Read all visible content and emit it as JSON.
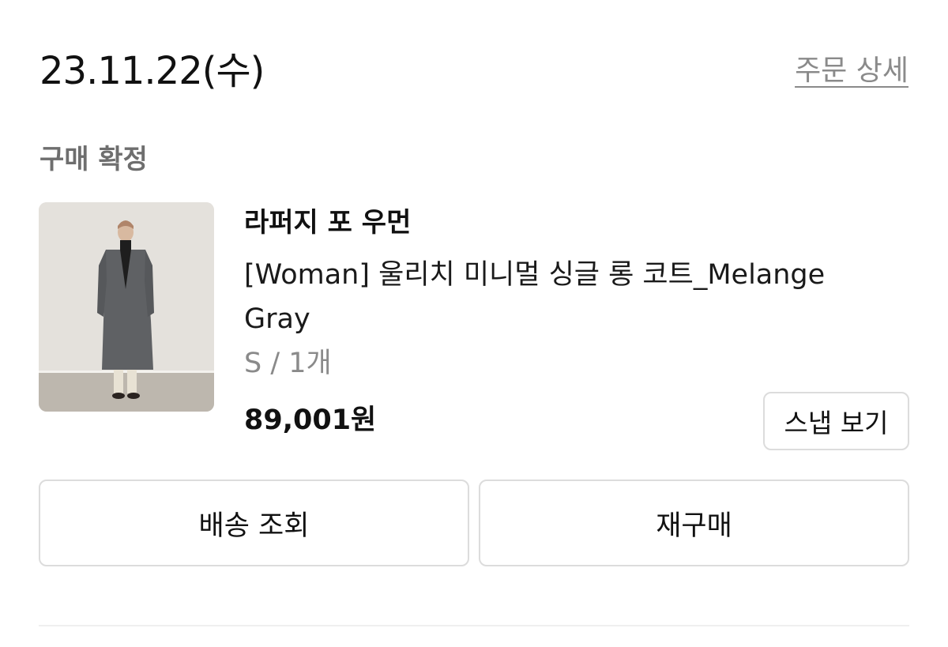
{
  "order": {
    "date": "23.11.22(수)",
    "detail_link": "주문 상세",
    "status": "구매 확정"
  },
  "product": {
    "brand": "라퍼지 포 우먼",
    "name": "[Woman] 울리치 미니멀 싱글 롱 코트_Melange Gray",
    "option": "S / 1개",
    "price": "89,001원",
    "snap_button": "스냅 보기"
  },
  "actions": {
    "track_delivery": "배송 조회",
    "reorder": "재구매"
  }
}
